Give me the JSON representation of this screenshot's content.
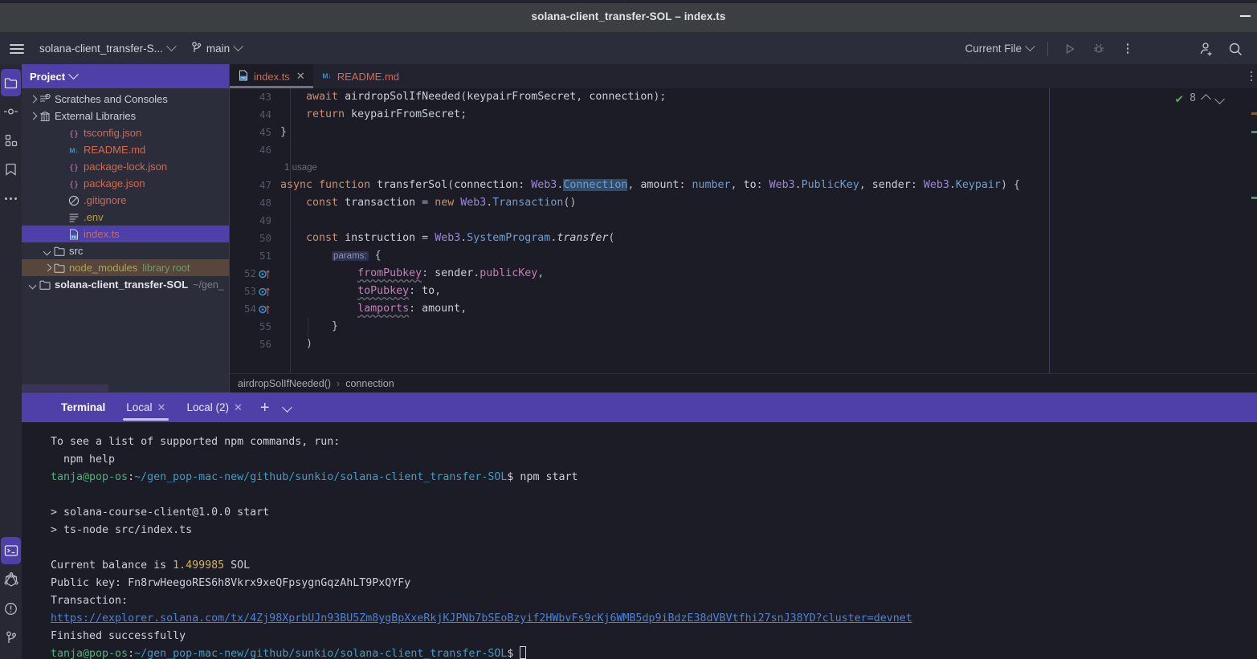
{
  "window": {
    "title": "solana-client_transfer-SOL – index.ts",
    "minimize_label": "—"
  },
  "toolbar": {
    "project_name": "solana-client_transfer-S...",
    "branch": "main",
    "run_config": "Current File",
    "icons": {
      "menu": "hamburger-icon",
      "branch": "branch-icon",
      "run": "run-icon",
      "debug": "debug-icon",
      "more": "more-options-icon",
      "share": "add-user-icon",
      "search": "search-icon"
    }
  },
  "left_strip": {
    "top": [
      {
        "name": "project",
        "icon": "folder-icon",
        "active": true
      },
      {
        "name": "commit",
        "icon": "commit-icon",
        "active": false
      },
      {
        "name": "structure",
        "icon": "structure-icon",
        "active": false
      },
      {
        "name": "bookmarks",
        "icon": "bookmarks-icon",
        "active": false
      },
      {
        "name": "more-tool-windows",
        "icon": "ellipsis-icon",
        "active": false
      }
    ],
    "bottom": [
      {
        "name": "terminal",
        "icon": "terminal-icon",
        "active": true
      },
      {
        "name": "graphql",
        "icon": "graphql-icon",
        "active": false
      },
      {
        "name": "problems",
        "icon": "warning-circle-icon",
        "active": false
      },
      {
        "name": "version-control",
        "icon": "branch-icon",
        "active": false
      }
    ]
  },
  "project_panel": {
    "title": "Project",
    "tree": [
      {
        "depth": 0,
        "arrow": "down",
        "icon": "folder-icon",
        "label": "solana-client_transfer-SOL",
        "suffix": "~/gen_",
        "state": "normal"
      },
      {
        "depth": 1,
        "arrow": "right",
        "icon": "folder-icon",
        "label": "node_modules",
        "suffix": "library root",
        "state": "highlight"
      },
      {
        "depth": 1,
        "arrow": "down",
        "icon": "folder-icon",
        "label": "src",
        "suffix": "",
        "state": "normal"
      },
      {
        "depth": 2,
        "arrow": "none",
        "icon": "ts-file-icon",
        "label": "index.ts",
        "suffix": "",
        "state": "selected"
      },
      {
        "depth": 2,
        "arrow": "none",
        "icon": "env-file-icon",
        "label": ".env",
        "suffix": "",
        "state": "normal"
      },
      {
        "depth": 2,
        "arrow": "none",
        "icon": "gitignore-icon",
        "label": ".gitignore",
        "suffix": "",
        "state": "normal"
      },
      {
        "depth": 2,
        "arrow": "none",
        "icon": "json-file-icon",
        "label": "package.json",
        "suffix": "",
        "state": "normal"
      },
      {
        "depth": 2,
        "arrow": "none",
        "icon": "json-file-icon",
        "label": "package-lock.json",
        "suffix": "",
        "state": "normal"
      },
      {
        "depth": 2,
        "arrow": "none",
        "icon": "markdown-file-icon",
        "label": "README.md",
        "suffix": "",
        "state": "normal"
      },
      {
        "depth": 2,
        "arrow": "none",
        "icon": "json-file-icon",
        "label": "tsconfig.json",
        "suffix": "",
        "state": "normal"
      },
      {
        "depth": 0,
        "arrow": "right",
        "icon": "library-icon",
        "label": "External Libraries",
        "suffix": "",
        "state": "normal"
      },
      {
        "depth": 0,
        "arrow": "right",
        "icon": "scratches-icon",
        "label": "Scratches and Consoles",
        "suffix": "",
        "state": "normal"
      }
    ]
  },
  "editor": {
    "tabs": [
      {
        "label": "README.md",
        "icon": "markdown-file-icon",
        "active": false,
        "closable": false
      },
      {
        "label": "index.ts",
        "icon": "ts-file-icon",
        "active": true,
        "closable": true
      }
    ],
    "inspection": {
      "status_icon": "green-check-icon",
      "count": "8",
      "prev": "chevron-up-icon",
      "next": "chevron-down-icon"
    },
    "breadcrumb": [
      "airdropSolIfNeeded()",
      "connection"
    ],
    "breadcrumb_separator": "›",
    "lines": [
      {
        "num": "43",
        "marker": "",
        "text": "    await airdropSolIfNeeded(keypairFromSecret, connection);"
      },
      {
        "num": "44",
        "marker": "",
        "text": "    return keypairFromSecret;"
      },
      {
        "num": "45",
        "marker": "",
        "text": "}"
      },
      {
        "num": "46",
        "marker": "",
        "text": ""
      },
      {
        "num": "",
        "marker": "",
        "text": "1 usage",
        "inlay": true
      },
      {
        "num": "47",
        "marker": "",
        "text": "async function transferSol(connection: Web3.Connection, amount: number, to: Web3.PublicKey, sender: Web3.Keypair) {"
      },
      {
        "num": "48",
        "marker": "",
        "text": "    const transaction = new Web3.Transaction()"
      },
      {
        "num": "49",
        "marker": "",
        "text": ""
      },
      {
        "num": "50",
        "marker": "",
        "text": "    const instruction = Web3.SystemProgram.transfer("
      },
      {
        "num": "51",
        "marker": "",
        "text": "        params: {"
      },
      {
        "num": "52",
        "marker": "override",
        "text": "            fromPubkey: sender.publicKey,"
      },
      {
        "num": "53",
        "marker": "override",
        "text": "            toPubkey: to,"
      },
      {
        "num": "54",
        "marker": "override",
        "text": "            lamports: amount,"
      },
      {
        "num": "55",
        "marker": "",
        "text": "        }"
      },
      {
        "num": "56",
        "marker": "",
        "text": "    )"
      }
    ]
  },
  "terminal": {
    "title": "Terminal",
    "tabs": [
      {
        "label": "Local",
        "active": true,
        "closable": true
      },
      {
        "label": "Local (2)",
        "active": false,
        "closable": true
      }
    ],
    "new_tab_label": "+",
    "options_icon": "chevron-down-icon",
    "output": [
      {
        "segments": [
          {
            "t": "To see a list of supported npm commands, run:",
            "c": "t-white"
          }
        ]
      },
      {
        "segments": [
          {
            "t": "  npm help",
            "c": "t-white"
          }
        ]
      },
      {
        "segments": [
          {
            "t": "tanja@pop-os",
            "c": "t-green"
          },
          {
            "t": ":",
            "c": "t-white"
          },
          {
            "t": "~/gen_pop-mac-new/github/sunkio/solana-client_transfer-SOL",
            "c": "t-cyan"
          },
          {
            "t": "$ npm start",
            "c": "t-white"
          }
        ]
      },
      {
        "segments": [
          {
            "t": "",
            "c": "t-white"
          }
        ]
      },
      {
        "segments": [
          {
            "t": "> solana-course-client@1.0.0 start",
            "c": "t-white"
          }
        ]
      },
      {
        "segments": [
          {
            "t": "> ts-node src/index.ts",
            "c": "t-white"
          }
        ]
      },
      {
        "segments": [
          {
            "t": "",
            "c": "t-white"
          }
        ]
      },
      {
        "segments": [
          {
            "t": "Current balance is ",
            "c": "t-white"
          },
          {
            "t": "1.499985",
            "c": "t-yellow"
          },
          {
            "t": " SOL",
            "c": "t-white"
          }
        ]
      },
      {
        "segments": [
          {
            "t": "Public key: Fn8rwHeegoRES6h8Vkrx9xeQFpsygnGqzAhLT9PxQYFy",
            "c": "t-white"
          }
        ]
      },
      {
        "segments": [
          {
            "t": "Transaction:",
            "c": "t-white"
          }
        ]
      },
      {
        "segments": [
          {
            "t": "https://explorer.solana.com/tx/4Zj98XprbUJn93BU5Zm8ygBpXxeRkjKJPNb7bSEoBzyif2HWbvFs9cKj6WMB5dp9iBdzE38dVBVtfhi27snJ38YD?cluster=devnet",
            "c": "t-link"
          }
        ]
      },
      {
        "segments": [
          {
            "t": "Finished successfully",
            "c": "t-white"
          }
        ]
      },
      {
        "segments": [
          {
            "t": "tanja@pop-os",
            "c": "t-green"
          },
          {
            "t": ":",
            "c": "t-white"
          },
          {
            "t": "~/gen_pop-mac-new/github/sunkio/solana-client_transfer-SOL",
            "c": "t-cyan"
          },
          {
            "t": "$ ",
            "c": "t-white"
          },
          {
            "t": "█",
            "c": "cursor"
          }
        ]
      }
    ]
  },
  "colors": {
    "accent_purple": "#4f3fa8",
    "editor_bg": "#1b1c25",
    "panel_bg": "#2b2d3a",
    "titlebar_bg": "#3c3f41",
    "link_blue": "#4c82d8",
    "prompt_green": "#49b675",
    "path_cyan": "#3d9ec9",
    "number_yellow": "#d5b263",
    "check_green": "#57a85c"
  }
}
